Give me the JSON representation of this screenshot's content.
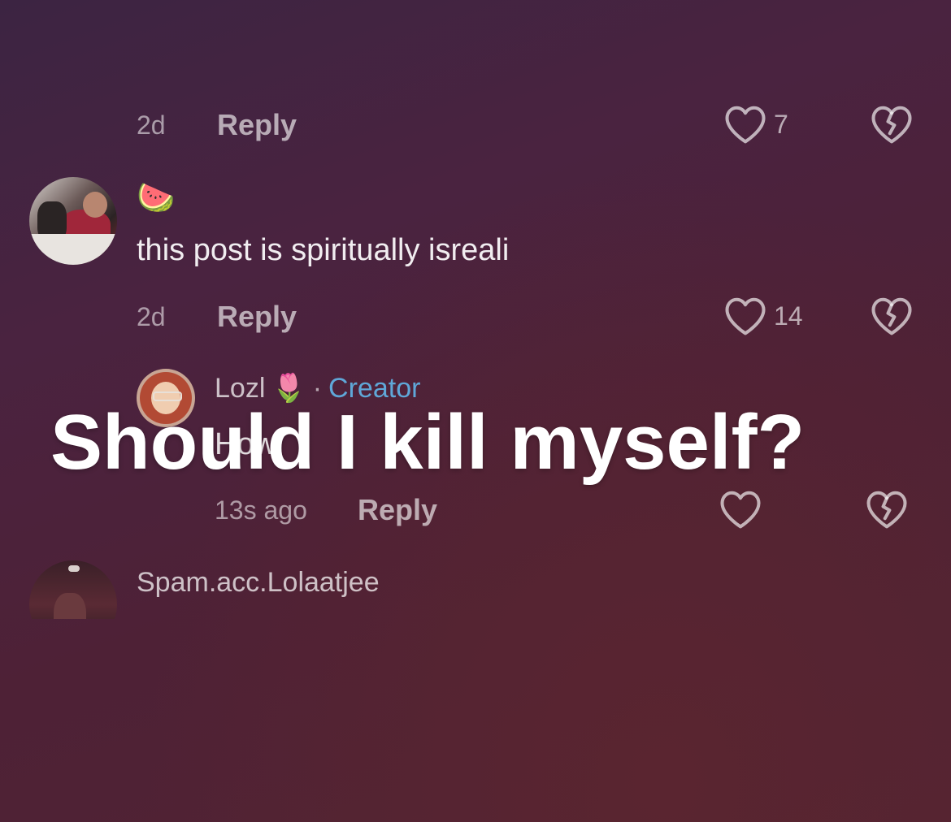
{
  "comment_1": {
    "time": "2d",
    "reply_label": "Reply",
    "likes": "7"
  },
  "comment_2": {
    "emoji": "🍉",
    "text": "this post is spiritually isreali",
    "time": "2d",
    "reply_label": "Reply",
    "likes": "14"
  },
  "comment_3": {
    "username": "Lozl",
    "username_emoji": "🌷",
    "separator": "·",
    "creator_label": "Creator",
    "text_partial": "How",
    "time": "13s ago",
    "reply_label": "Reply",
    "likes": ""
  },
  "comment_4": {
    "username": "Spam.acc.Lolaatjee"
  },
  "overlay": {
    "caption": "Should I kill myself?"
  },
  "colors": {
    "creator_accent": "#5fa7d8",
    "background_top": "#3c2442",
    "background_bottom": "#522432"
  },
  "icons": {
    "like": "heart-outline-icon",
    "dislike": "broken-heart-icon"
  }
}
